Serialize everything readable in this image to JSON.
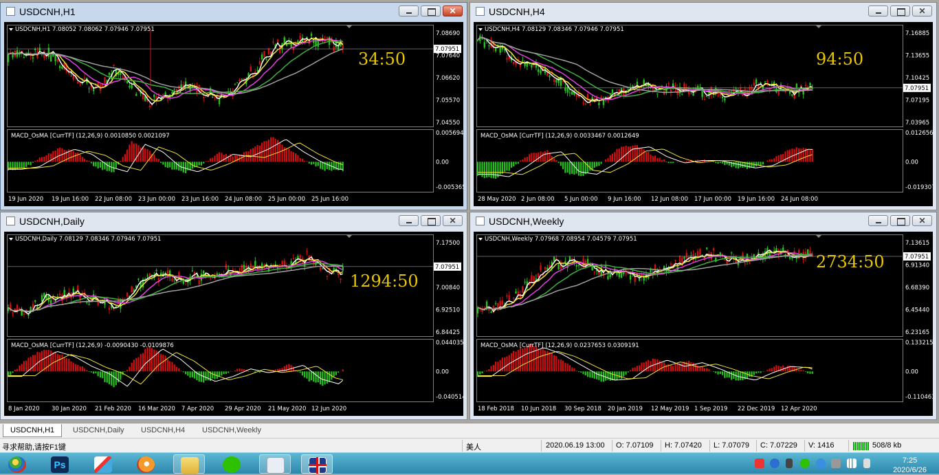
{
  "windows": [
    {
      "id": "h1",
      "title": "USDCNH,H1",
      "active": true,
      "info": "USDCNH,H1  7.08052 7.08062 7.07946 7.07951",
      "macd_info": "MACD_OsMA [CurrTF] (12,26,9) 0.0010850 0.0021097",
      "countdown": "34:50",
      "price_labels": [
        "7.08690",
        "7.07640",
        "7.06620",
        "7.05570",
        "7.04550"
      ],
      "current_price": "7.07951",
      "macd_labels": [
        "0.0056945",
        "0.00",
        "-0.005365"
      ],
      "time_labels": [
        "19 Jun 2020",
        "19 Jun 16:00",
        "22 Jun 08:00",
        "23 Jun 00:00",
        "23 Jun 16:00",
        "24 Jun 08:00",
        "25 Jun 00:00",
        "25 Jun 16:00"
      ]
    },
    {
      "id": "h4",
      "title": "USDCNH,H4",
      "active": false,
      "info": "USDCNH,H4  7.08129 7.08346 7.07946 7.07951",
      "macd_info": "MACD_OsMA [CurrTF] (12,26,9) 0.0033467 0.0012649",
      "countdown": "94:50",
      "price_labels": [
        "7.16885",
        "7.13655",
        "7.10425",
        "7.07195",
        "7.03965"
      ],
      "current_price": "7.07951",
      "macd_labels": [
        "0.0126563",
        "0.00",
        "-0.0193077"
      ],
      "time_labels": [
        "28 May 2020",
        "2 Jun 08:00",
        "5 Jun 00:00",
        "9 Jun 16:00",
        "12 Jun 08:00",
        "17 Jun 00:00",
        "19 Jun 16:00",
        "24 Jun 08:00"
      ]
    },
    {
      "id": "d1",
      "title": "USDCNH,Daily",
      "active": false,
      "info": "USDCNH,Daily  7.08129 7.08346 7.07946 7.07951",
      "macd_info": "MACD_OsMA [CurrTF] (12,26,9) -0.0090430 -0.0109876",
      "countdown": "1294:50",
      "price_labels": [
        "7.17500",
        "7.09170",
        "7.00840",
        "6.92510",
        "6.84425"
      ],
      "current_price": "7.07951",
      "macd_labels": [
        "0.0440354",
        "0.00",
        "-0.040514"
      ],
      "time_labels": [
        "8 Jan 2020",
        "30 Jan 2020",
        "21 Feb 2020",
        "16 Mar 2020",
        "7 Apr 2020",
        "29 Apr 2020",
        "21 May 2020",
        "12 Jun 2020"
      ]
    },
    {
      "id": "w1",
      "title": "USDCNH,Weekly",
      "active": false,
      "info": "USDCNH,Weekly  7.07968 7.08954 7.04579 7.07951",
      "macd_info": "MACD_OsMA [CurrTF] (12,26,9) 0.0237653 0.0309191",
      "countdown": "2734:50",
      "price_labels": [
        "7.13615",
        "6.91340",
        "6.68390",
        "6.45440",
        "6.23165"
      ],
      "current_price": "7.07951",
      "macd_labels": [
        "0.133215",
        "0.00",
        "-0.110463"
      ],
      "time_labels": [
        "18 Feb 2018",
        "10 Jun 2018",
        "30 Sep 2018",
        "20 Jan 2019",
        "12 May 2019",
        "1 Sep 2019",
        "22 Dec 2019",
        "12 Apr 2020"
      ]
    }
  ],
  "tabs": [
    "USDCNH,H1",
    "USDCNH,Daily",
    "USDCNH,H4",
    "USDCNH,Weekly"
  ],
  "status": {
    "help": "寻求帮助,请按F1键",
    "profile": "美人",
    "datetime": "2020.06.19 13:00",
    "open": "O: 7.07109",
    "high": "H: 7.07420",
    "low": "L: 7.07079",
    "close": "C: 7.07229",
    "volume": "V: 1416",
    "traffic": "508/8 kb"
  },
  "taskbar": {
    "apps": [
      "start-orb",
      "photoshop",
      "paint-tool",
      "firefox",
      "file-explorer",
      "wechat",
      "notepad",
      "uk-flag-app"
    ],
    "time": "7:25",
    "date": "2020/6/26"
  },
  "colors": {
    "bull": "#26c21e",
    "bear": "#d01010",
    "ma_white": "#ffffff",
    "ma_yellow": "#f2e43a",
    "ma_magenta": "#e040e0",
    "ma_green": "#40b040",
    "ma_gray": "#a0a0a0",
    "countdown": "#e8c700"
  }
}
